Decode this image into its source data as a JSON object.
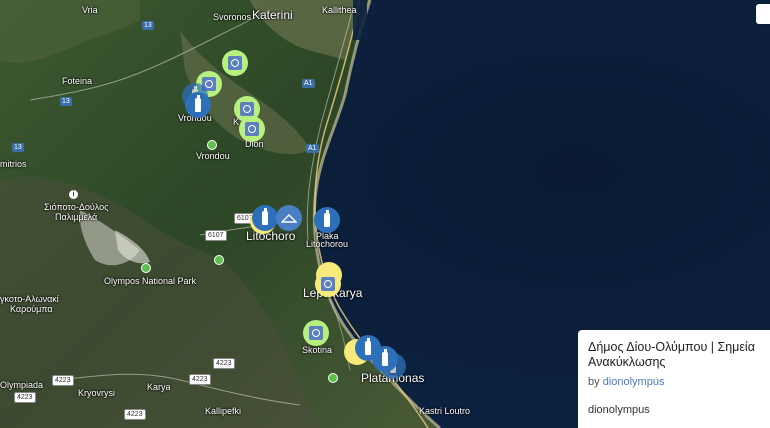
{
  "map": {
    "place_labels": {
      "katerini": "Katerini",
      "kallithea": "Kallithea",
      "svoronos": "Svoronos",
      "vria": "Vria",
      "foteina": "Foteina",
      "vrontou_top": "Vrondou",
      "vrontou": "Vrondou",
      "dion": "Dion",
      "k": "K",
      "mitrios": "mitrios",
      "siopoto": "Σιόποτο-Δούλος",
      "palimmela": "Παλιμμελά",
      "litochoro": "Litochoro",
      "plaka": "Plaka",
      "plaka2": "Litochorou",
      "leptokarya": "Leptokarya",
      "olympos_np": "Olympos National Park",
      "agkoto": "γκοτο-Αλωνακί",
      "karoumpa": "Καρούμπα",
      "skotina": "Skotina",
      "platamonas": "Platamonas",
      "olympiada": "Olympiada",
      "kryovrysi": "Kryovrysi",
      "karya": "Karya",
      "kallipefki": "Kallipefki",
      "kastri": "Kastri Loutro"
    },
    "road_labels": {
      "r13a": "13",
      "r13b": "13",
      "r13c": "13",
      "a1a": "A1",
      "a1b": "A1",
      "r6107a": "6107",
      "r6107b": "6107",
      "r4223a": "4223",
      "r4223b": "4223",
      "r4223c": "4223",
      "r4223d": "4223",
      "r4223e": "4223"
    },
    "marker_types": {
      "green": "recycling-bin",
      "blue": "glass-bottle",
      "yellow": "recycling-bin"
    },
    "colors": {
      "sea": "#0b1e3a",
      "land": "#2f4b2a",
      "marker_green": "#b8f080",
      "marker_blue": "#2d6fb8",
      "marker_yellow": "#f6ea7a"
    }
  },
  "info_card": {
    "title": "Δήμος Δίου-Ολύμπου | Σημεία Ανακύκλωσης",
    "by_prefix": "by",
    "author_link": "dionolympus",
    "owner": "dionolympus"
  }
}
